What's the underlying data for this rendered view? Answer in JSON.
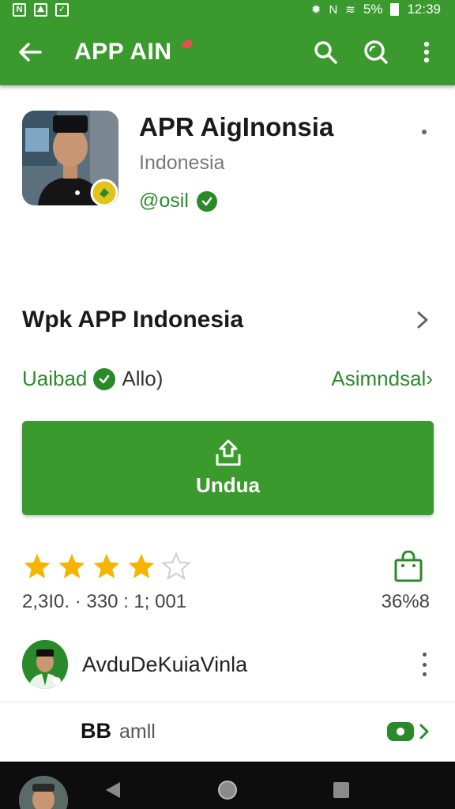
{
  "status_bar": {
    "battery": "5%",
    "time": "12:39"
  },
  "app_bar": {
    "title": "APP AIN",
    "icons": [
      "back-arrow-icon",
      "search-icon",
      "search-alt-icon",
      "more-vert-icon"
    ]
  },
  "app": {
    "name": "APR AigInonsia",
    "region": "Indonesia",
    "developer": "@osil"
  },
  "section": {
    "title": "Wpk APP Indonesia",
    "meta_status": "Uaibad",
    "meta_extra": "Allo)",
    "meta_link": "Asimndsal"
  },
  "install": {
    "label": "Undua",
    "icon": "upload-icon"
  },
  "rating": {
    "stars": 4,
    "max_stars": 5,
    "counts_text": "2,3I0. · 330 : 1; 001",
    "downloads_text": "36%8"
  },
  "user": {
    "name": "AvduDeKuiaVinla"
  },
  "review": {
    "bold": "BB",
    "light": "amll"
  },
  "colors": {
    "primary": "#3a9a2e",
    "accent_text": "#2a8a2a",
    "star": "#f5b400"
  }
}
